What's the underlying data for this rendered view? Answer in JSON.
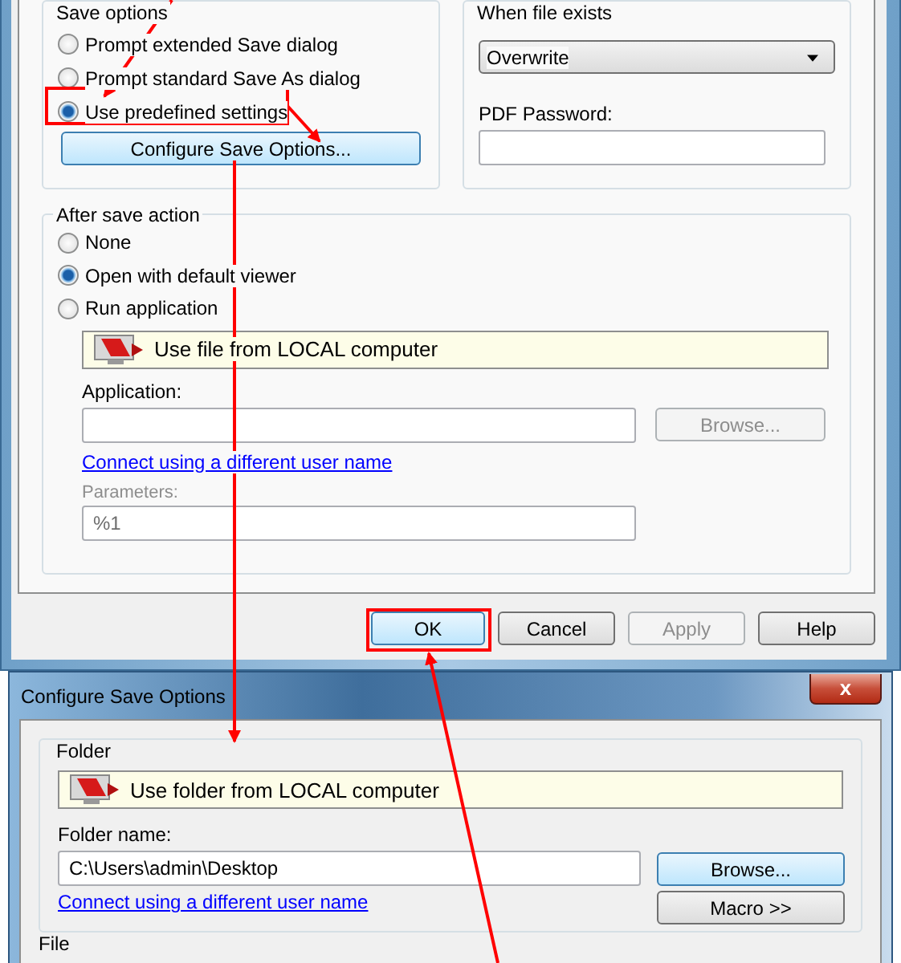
{
  "main_dialog": {
    "save_options": {
      "title": "Save options",
      "options": [
        {
          "label": "Prompt extended Save dialog",
          "selected": false
        },
        {
          "label": "Prompt standard Save As dialog",
          "selected": false
        },
        {
          "label": "Use predefined settings",
          "selected": true
        }
      ],
      "button": "Configure Save Options..."
    },
    "when_file_exists": {
      "title": "When file exists",
      "dropdown": "Overwrite",
      "password_label": "PDF Password:"
    },
    "after_save_action": {
      "title": "After save action",
      "options": [
        {
          "label": "None",
          "selected": false
        },
        {
          "label": "Open with default viewer",
          "selected": true
        },
        {
          "label": "Run application",
          "selected": false
        }
      ],
      "location_bar": "Use file from LOCAL computer",
      "application_label": "Application:",
      "browse_button": {
        "label": "Browse...",
        "disabled": true
      },
      "link": "Connect using a different user name",
      "parameters_label": "Parameters:",
      "parameters_value": "%1"
    },
    "buttons": [
      {
        "label": "OK",
        "disabled": false,
        "default": true
      },
      {
        "label": "Cancel",
        "disabled": false,
        "default": false
      },
      {
        "label": "Apply",
        "disabled": true,
        "default": false
      },
      {
        "label": "Help",
        "disabled": false,
        "default": false
      }
    ]
  },
  "configure_dialog": {
    "title": "Configure Save Options",
    "close": "x",
    "folder": {
      "title": "Folder",
      "location_bar": "Use folder from LOCAL computer",
      "folder_name_label": "Folder name:",
      "folder_name_value": "C:\\Users\\admin\\Desktop",
      "browse_button": {
        "label": "Browse...",
        "default": true
      },
      "link": "Connect using a different user name",
      "macro_button": {
        "label": "Macro >>",
        "default": false
      }
    },
    "file_group_title": "File"
  }
}
